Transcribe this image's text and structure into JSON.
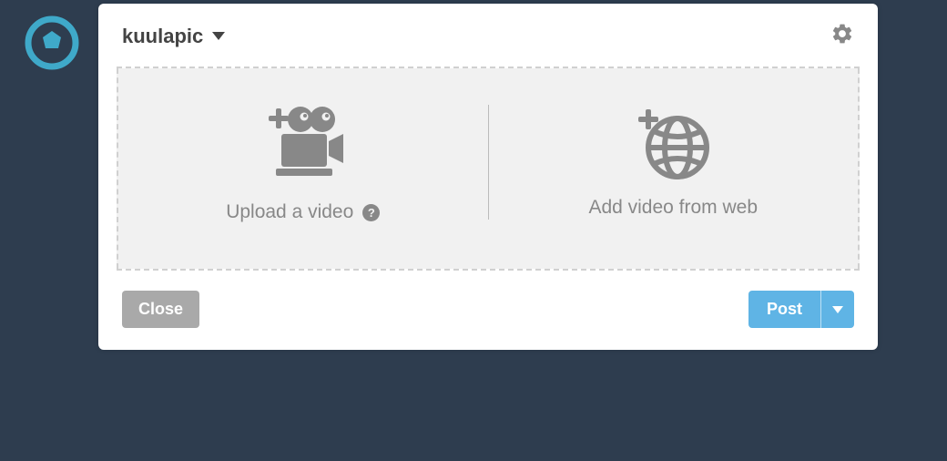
{
  "account": {
    "name": "kuulapic"
  },
  "options": {
    "upload": {
      "label": "Upload a video"
    },
    "web": {
      "label": "Add video from web"
    }
  },
  "buttons": {
    "close": "Close",
    "post": "Post"
  },
  "colors": {
    "accent": "#3fa9c9",
    "post_button": "#5fb4e5",
    "muted": "#888888"
  }
}
